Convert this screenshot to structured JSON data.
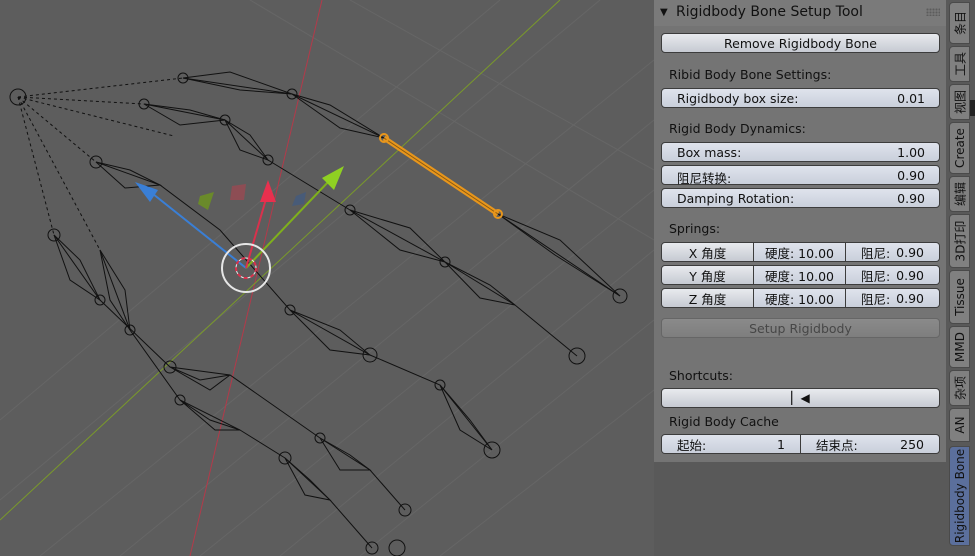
{
  "panel": {
    "title": "Rigidbody Bone Setup Tool",
    "remove_button": "Remove Rigidbody Bone",
    "bone_settings_label": "Ribid Body Bone Settings:",
    "box_size": {
      "label": "Rigidbody box size:",
      "value": "0.01"
    },
    "dynamics_label": "Rigid Body Dynamics:",
    "box_mass": {
      "label": "Box mass:",
      "value": "1.00"
    },
    "damping_translation": {
      "label": "阻尼转换:",
      "value": "0.90"
    },
    "damping_rotation": {
      "label": "Damping Rotation:",
      "value": "0.90"
    },
    "springs_label": "Springs:",
    "springs": [
      {
        "axis": "X 角度",
        "stiffness": "硬度: 10.00",
        "damping_label": "阻尼:",
        "damping_value": "0.90"
      },
      {
        "axis": "Y 角度",
        "stiffness": "硬度: 10.00",
        "damping_label": "阻尼:",
        "damping_value": "0.90"
      },
      {
        "axis": "Z 角度",
        "stiffness": "硬度: 10.00",
        "damping_label": "阻尼:",
        "damping_value": "0.90"
      }
    ],
    "setup_button": "Setup Rigidbody",
    "shortcuts_label": "Shortcuts:",
    "cache_label": "Rigid Body Cache",
    "cache_start": {
      "label": "起始:",
      "value": "1"
    },
    "cache_end": {
      "label": "结束点:",
      "value": "250"
    }
  },
  "tabs": [
    "条目",
    "工具",
    "视图",
    "Create",
    "编辑",
    "3D打印",
    "Tissue",
    "MMD",
    "杂项",
    "AN",
    "Rigidbody Bone"
  ],
  "active_tab": "Rigidbody Bone",
  "colors": {
    "x_axis": "#d9314c",
    "y_axis": "#7fb01c",
    "z_axis": "#3a7fd6",
    "selected_bone": "#e8961c",
    "active_tab": "#5b6f9c"
  }
}
